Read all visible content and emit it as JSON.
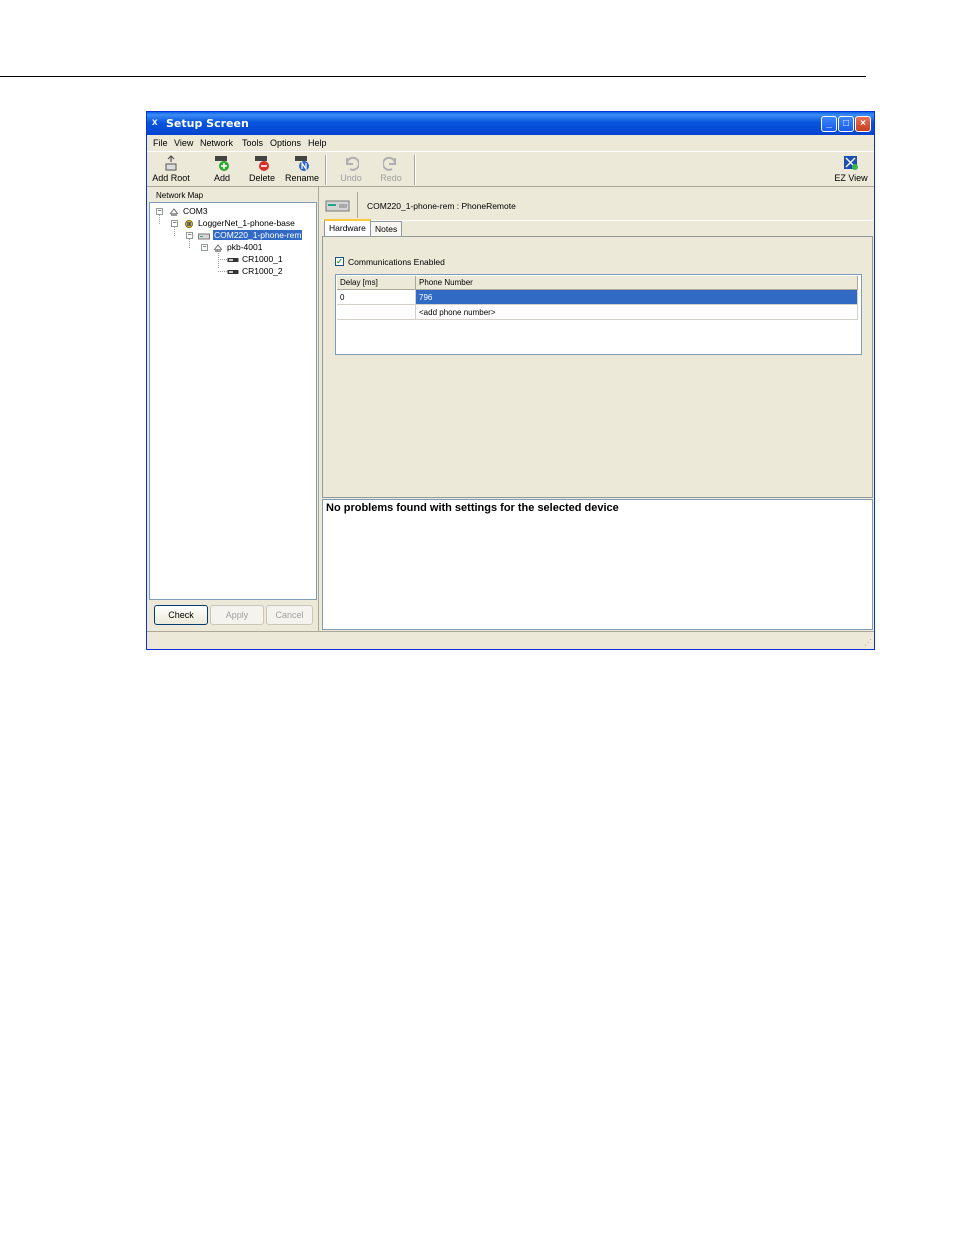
{
  "window": {
    "title": "Setup Screen",
    "app_icon": "x",
    "controls": {
      "minimize": "_",
      "maximize": "□",
      "close": "×"
    }
  },
  "menu": [
    "File",
    "View",
    "Network",
    "Tools",
    "Options",
    "Help"
  ],
  "toolbar": {
    "add_root": "Add Root",
    "add": "Add",
    "delete": "Delete",
    "rename": "Rename",
    "undo": "Undo",
    "redo": "Redo",
    "ez_view": "EZ View"
  },
  "network_map": {
    "label": "Network Map",
    "nodes": {
      "com3": "COM3",
      "loggernet": "LoggerNet_1-phone-base",
      "com220": "COM220_1-phone-rem",
      "pakbus": "pkb-4001",
      "cr1000_1": "CR1000_1",
      "cr1000_2": "CR1000_2"
    },
    "expander": "−"
  },
  "buttons": {
    "check": "Check",
    "apply": "Apply",
    "cancel": "Cancel"
  },
  "device": {
    "title": "COM220_1-phone-rem : PhoneRemote"
  },
  "tabs": [
    "Hardware",
    "Notes"
  ],
  "hardware": {
    "check_mark": "✓",
    "communications_enabled": "Communications Enabled",
    "table": {
      "headers": [
        "Delay [ms]",
        "Phone Number"
      ],
      "rows": [
        {
          "delay": "0",
          "phone": "796"
        },
        {
          "delay": "",
          "phone": "<add phone number>"
        }
      ]
    }
  },
  "message": "No problems found with settings for the selected device",
  "status": {
    "grip": "⋰"
  },
  "colors": {
    "selection": "#316ac5",
    "titlebar": "#0a5fe6"
  }
}
